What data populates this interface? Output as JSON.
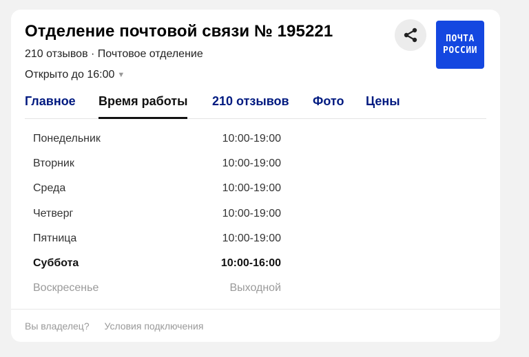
{
  "header": {
    "title": "Отделение почтовой связи № 195221",
    "reviews_summary": "210 отзывов · Почтовое отделение",
    "open_status": "Открыто до 16:00",
    "caret": "▼"
  },
  "logo": {
    "line1": "ПОЧТА",
    "line2": "РОССИИ",
    "color": "#1447e0"
  },
  "tabs": [
    {
      "label": "Главное",
      "active": false
    },
    {
      "label": "Время работы",
      "active": true
    },
    {
      "label": "210 отзывов",
      "active": false
    },
    {
      "label": "Фото",
      "active": false
    },
    {
      "label": "Цены",
      "active": false
    }
  ],
  "hours": [
    {
      "day": "Понедельник",
      "time": "10:00-19:00"
    },
    {
      "day": "Вторник",
      "time": "10:00-19:00"
    },
    {
      "day": "Среда",
      "time": "10:00-19:00"
    },
    {
      "day": "Четверг",
      "time": "10:00-19:00"
    },
    {
      "day": "Пятница",
      "time": "10:00-19:00"
    },
    {
      "day": "Суббота",
      "time": "10:00-16:00",
      "today": true
    },
    {
      "day": "Воскресенье",
      "time": "Выходной",
      "off": true
    }
  ],
  "footer": {
    "owner_link": "Вы владелец?",
    "terms_link": "Условия подключения"
  },
  "icons": {
    "share": "share-icon"
  },
  "colors": {
    "tab_link": "#001a80",
    "background": "#f2f2f2"
  }
}
